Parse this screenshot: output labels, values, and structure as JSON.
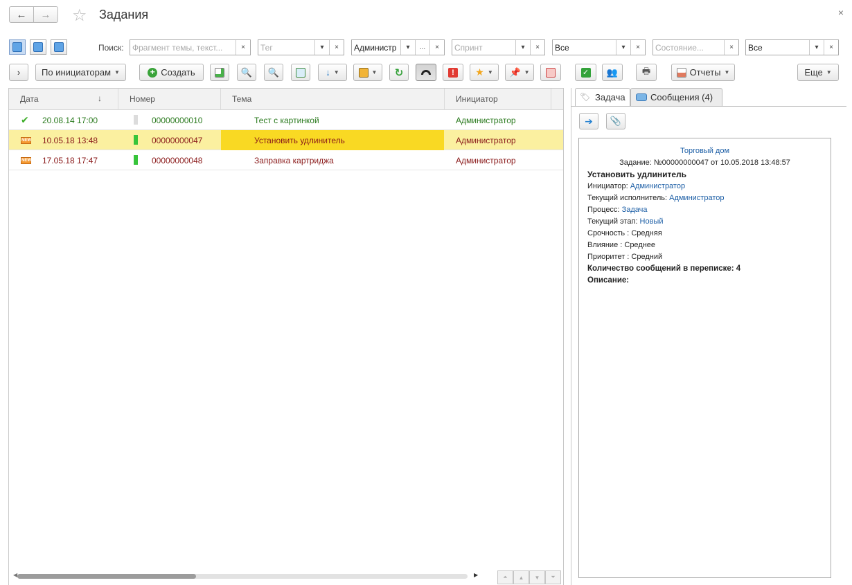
{
  "window": {
    "title": "Задания",
    "close_label": "×"
  },
  "nav": {
    "back": "←",
    "forward": "→"
  },
  "filters": {
    "search_label": "Поиск:",
    "search_placeholder": "Фрагмент темы, текст...",
    "tag_placeholder": "Тег",
    "initiator_value": "Администр",
    "sprint_placeholder": "Спринт",
    "all1_value": "Все",
    "state_placeholder": "Состояние...",
    "all2_value": "Все",
    "ellipsis": "...",
    "clear": "×",
    "dropdown": "▾"
  },
  "toolbar": {
    "expand": "›",
    "group_by": "По инициаторам",
    "create": "Создать",
    "reports": "Отчеты",
    "more": "Еще"
  },
  "table": {
    "columns": [
      "Дата",
      "Номер",
      "Тема",
      "Инициатор"
    ],
    "sort_indicator": "↓",
    "rows": [
      {
        "date": "20.08.14 17:00",
        "number": "00000000010",
        "theme": "Тест с картинкой",
        "initiator": "Администратор",
        "status": "done"
      },
      {
        "date": "10.05.18 13:48",
        "number": "00000000047",
        "theme": "Установить удлинитель",
        "initiator": "Администратор",
        "status": "new"
      },
      {
        "date": "17.05.18 17:47",
        "number": "00000000048",
        "theme": "Заправка картриджа",
        "initiator": "Администратор",
        "status": "new"
      }
    ],
    "selected_row": 1
  },
  "right_panel": {
    "tabs": [
      "Задача",
      "Сообщения (4)"
    ],
    "company": "Торговый дом",
    "task_header": "Задание: №00000000047 от 10.05.2018 13:48:57",
    "task_title": "Установить удлинитель",
    "fields": [
      {
        "label": "Инициатор: ",
        "value": "Администратор",
        "link": true
      },
      {
        "label": "Текущий исполнитель: ",
        "value": "Администратор",
        "link": true
      },
      {
        "label": "Процесс: ",
        "value": "Задача",
        "link": true
      },
      {
        "label": "Текущий этап: ",
        "value": "Новый",
        "link": true
      },
      {
        "label": "Срочность : ",
        "value": "Средняя",
        "link": false
      },
      {
        "label": "Влияние : ",
        "value": "Среднее",
        "link": false
      },
      {
        "label": "Приоритет : ",
        "value": "Средний",
        "link": false
      }
    ],
    "messages_count": "Количество сообщений в переписке: 4",
    "description_label": "Описание:"
  },
  "colors": {
    "selected_row": "#fbf0a0",
    "theme_highlight": "#f9d923",
    "green": "#2a7a1e",
    "red": "#8a1a1a"
  },
  "new_badge": "NEW",
  "check_mark": "✔"
}
